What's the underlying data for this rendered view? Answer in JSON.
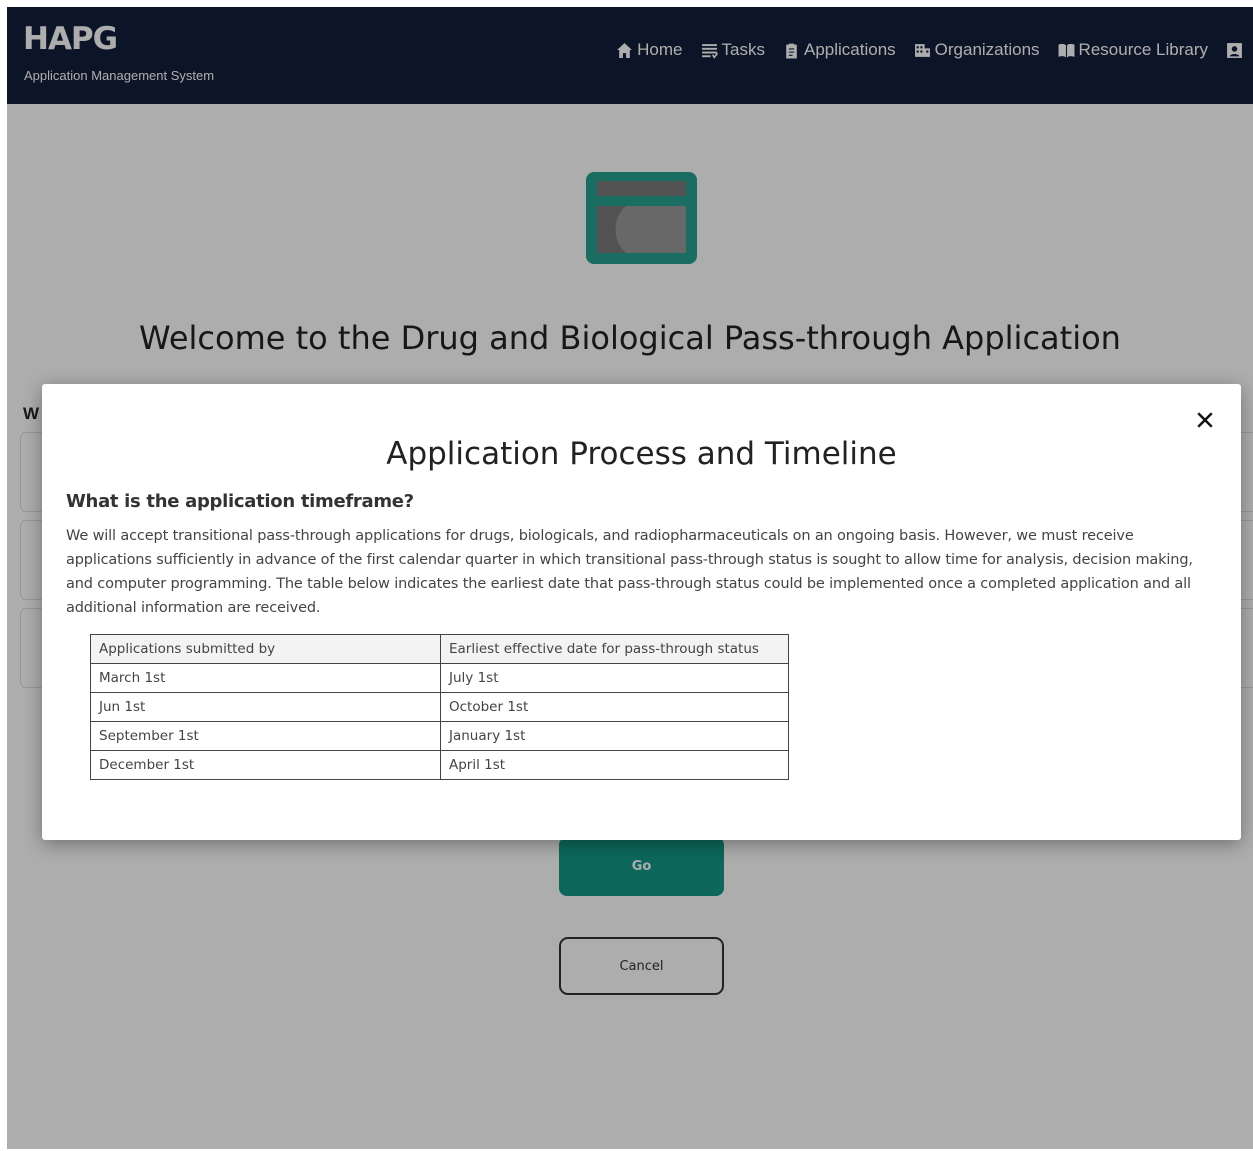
{
  "navbar": {
    "brand": "HAPG",
    "subtitle": "Application Management System",
    "links": [
      {
        "label": "Home",
        "icon": "home-icon"
      },
      {
        "label": "Tasks",
        "icon": "tasks-icon"
      },
      {
        "label": "Applications",
        "icon": "clipboard-icon"
      },
      {
        "label": "Organizations",
        "icon": "building-icon"
      },
      {
        "label": "Resource Library",
        "icon": "book-icon"
      }
    ],
    "user_icon": "user-icon"
  },
  "page": {
    "title": "Welcome to the Drug and Biological Pass-through Application",
    "section_letter": "W",
    "go_label": "Go",
    "cancel_label": "Cancel",
    "hero_icon": "credit-card-icon"
  },
  "modal": {
    "title": "Application Process and Timeline",
    "subtitle": "What is the application timeframe?",
    "body": "We will accept transitional pass-through applications for drugs, biologicals, and radiopharmaceuticals on an ongoing basis. However, we must receive applications sufficiently in advance of the first calendar quarter in which transitional pass-through status is sought to allow time for analysis, decision making, and computer programming. The table below indicates the earliest date that pass-through status could be implemented once a completed application and all additional information are received.",
    "table": {
      "headers": [
        "Applications submitted by",
        "Earliest effective date for pass-through status"
      ],
      "rows": [
        [
          "March 1st",
          "July 1st"
        ],
        [
          "Jun 1st",
          "October 1st"
        ],
        [
          "September 1st",
          "January 1st"
        ],
        [
          "December 1st",
          "April 1st"
        ]
      ]
    }
  },
  "colors": {
    "navbar": "#13203a",
    "accent": "#149a86",
    "hero_icon": "#25a28f",
    "overlay": "rgba(0,0,0,0.32)"
  }
}
